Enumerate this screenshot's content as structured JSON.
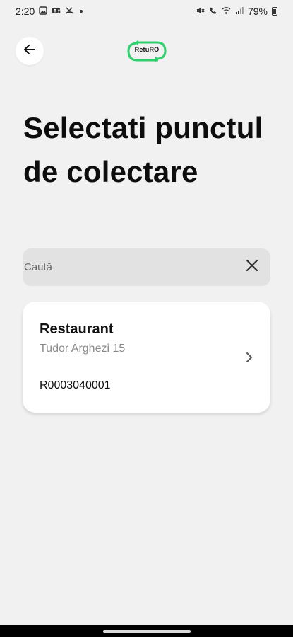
{
  "status_bar": {
    "time": "2:20",
    "battery": "79%",
    "left_icons": [
      "gallery-icon",
      "teams-icon",
      "missed-call-icon"
    ],
    "right_icons": [
      "mute-icon",
      "wifi-call-icon",
      "wifi-icon",
      "signal-icon",
      "battery-icon"
    ]
  },
  "header": {
    "logo_text": "RetuRO",
    "brand_color": "#2fcf6e"
  },
  "title": "Selectati punctul de colectare",
  "search": {
    "placeholder": "Caută",
    "value": ""
  },
  "results": [
    {
      "name": "Restaurant",
      "address": "Tudor Arghezi 15",
      "code": "R0003040001"
    }
  ]
}
